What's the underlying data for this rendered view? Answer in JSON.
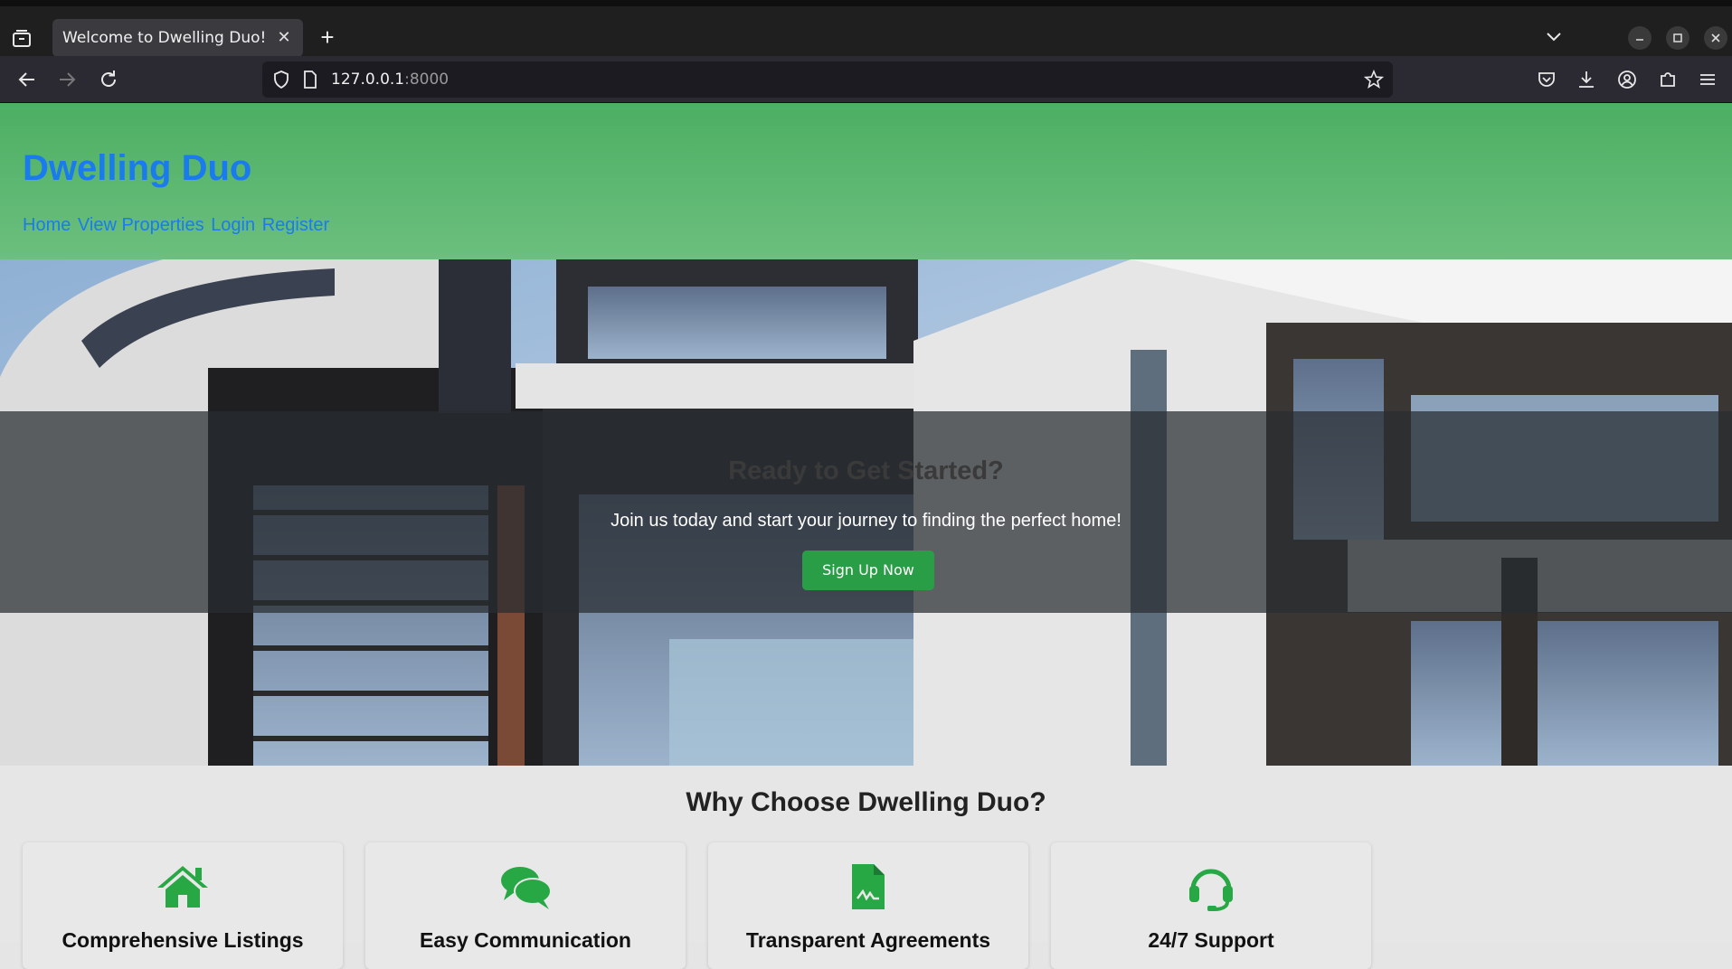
{
  "browser": {
    "tab_title": "Welcome to Dwelling Duo!",
    "url_host": "127.0.0.1",
    "url_port": ":8000"
  },
  "site": {
    "title": "Dwelling Duo",
    "nav": [
      "Home",
      "View Properties",
      "Login",
      "Register"
    ]
  },
  "hero": {
    "heading": "Ready to Get Started?",
    "text": "Join us today and start your journey to finding the perfect home!",
    "button_label": "Sign Up Now"
  },
  "features": {
    "title": "Why Choose Dwelling Duo?",
    "items": [
      {
        "label": "Comprehensive Listings",
        "icon": "house-icon"
      },
      {
        "label": "Easy Communication",
        "icon": "chat-bubbles-icon"
      },
      {
        "label": "Transparent Agreements",
        "icon": "contract-document-icon"
      },
      {
        "label": "24/7 Support",
        "icon": "headset-icon"
      }
    ]
  },
  "colors": {
    "header_green": "#4caf62",
    "brand_blue": "#1a7bef",
    "button_green": "#2a9e47",
    "icon_green": "#28a745"
  }
}
